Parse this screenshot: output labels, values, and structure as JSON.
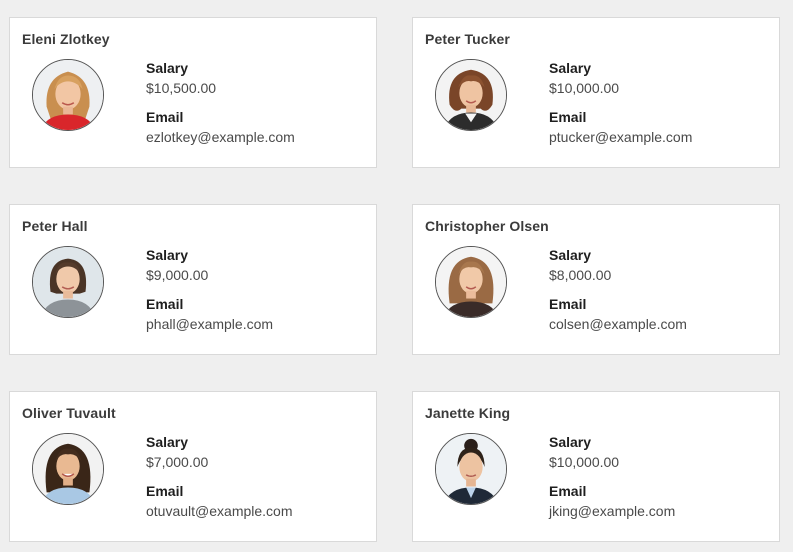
{
  "labels": {
    "salary": "Salary",
    "email": "Email"
  },
  "colors": {
    "background": "#efefef",
    "card": "#ffffff",
    "card_border": "#d9d9d9",
    "name_text": "#3b3b3b",
    "value_text": "#4a4a4a"
  },
  "employees": [
    {
      "name": "Eleni Zlotkey",
      "salary": "$10,500.00",
      "email": "ezlotkey@example.com",
      "avatar": "woman-blonde-red-top-photo-icon"
    },
    {
      "name": "Peter Tucker",
      "salary": "$10,000.00",
      "email": "ptucker@example.com",
      "avatar": "woman-brown-curly-hair-photo-icon"
    },
    {
      "name": "Peter Hall",
      "salary": "$9,000.00",
      "email": "phall@example.com",
      "avatar": "woman-dark-bob-grey-top-photo-icon"
    },
    {
      "name": "Christopher Olsen",
      "salary": "$8,000.00",
      "email": "colsen@example.com",
      "avatar": "woman-light-brown-long-hair-photo-icon"
    },
    {
      "name": "Oliver Tuvault",
      "salary": "$7,000.00",
      "email": "otuvault@example.com",
      "avatar": "woman-long-dark-hair-blue-shirt-photo-icon"
    },
    {
      "name": "Janette King",
      "salary": "$10,000.00",
      "email": "jking@example.com",
      "avatar": "woman-hair-bun-dark-suit-photo-icon"
    }
  ]
}
